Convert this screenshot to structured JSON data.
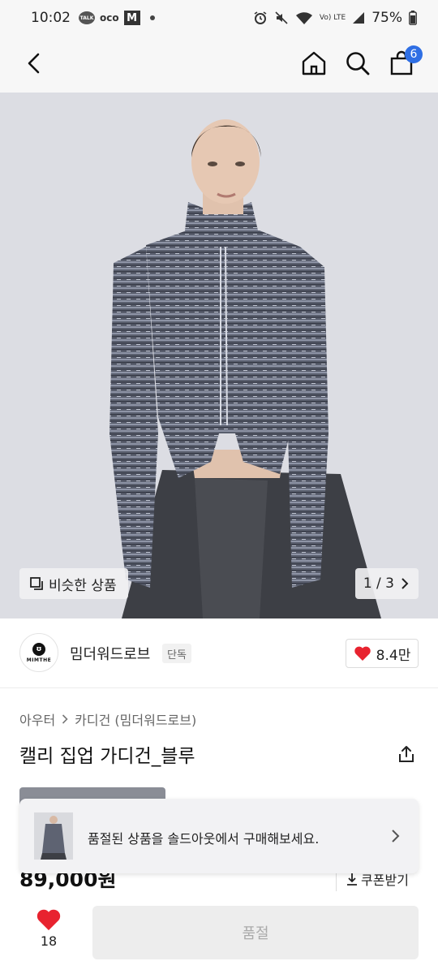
{
  "status_bar": {
    "time": "10:02",
    "talk_label": "TALK",
    "oco_label": "oco",
    "m_label": "M",
    "battery": "75%",
    "volte": "Vo) LTE"
  },
  "header": {
    "cart_count": "6"
  },
  "image": {
    "similar_label": "비슷한 상품",
    "pager": "1 / 3"
  },
  "brand": {
    "logo_text": "MIMTHE",
    "name": "밈더워드로브",
    "badge": "단독",
    "like_count": "8.4만"
  },
  "product": {
    "category_parent": "아우터",
    "category_child": "카디건 (밈더워드로브)",
    "title": "캘리 집업 가디건_블루",
    "price": "89,000원",
    "coupon_label": "쿠폰받기"
  },
  "soldout_banner": {
    "text": "품절된 상품을 솔드아웃에서 구매해보세요."
  },
  "bottom_bar": {
    "wish_count": "18",
    "main_button": "품절"
  },
  "colors": {
    "accent_badge": "#2f6fe4",
    "heart": "#e8232f",
    "disabled_button": "#ededed"
  }
}
